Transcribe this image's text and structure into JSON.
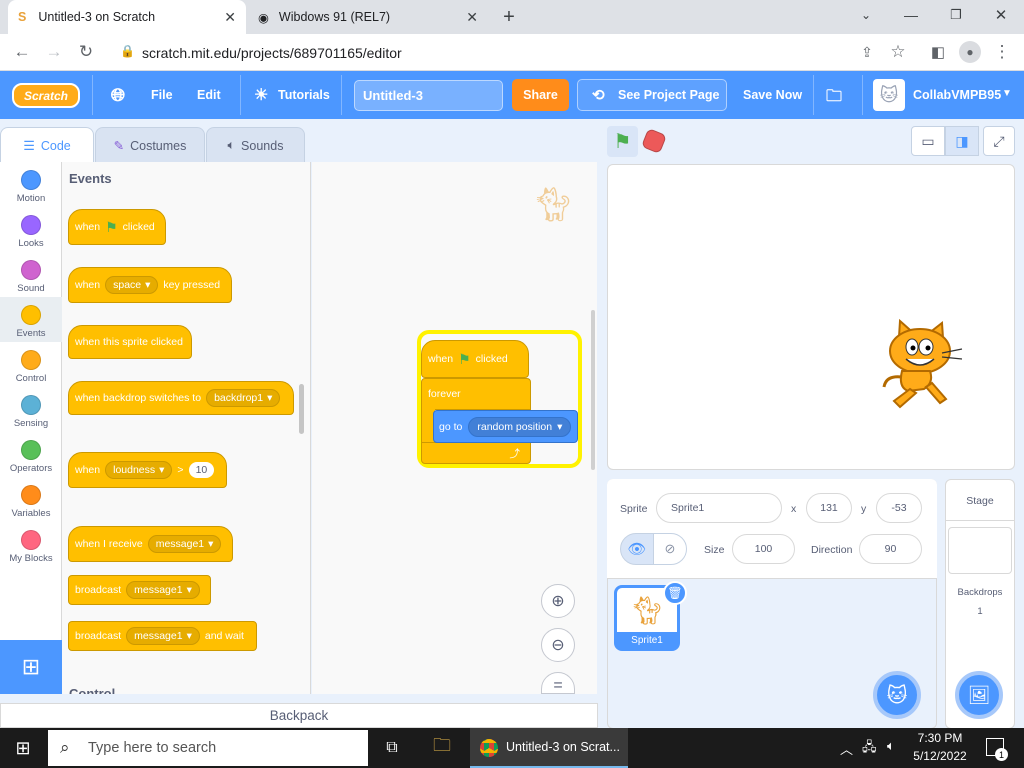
{
  "browser": {
    "tabs": [
      {
        "title": "Untitled-3 on Scratch"
      },
      {
        "title": "Wibdows 91 (REL7)"
      }
    ],
    "url": "scratch.mit.edu/projects/689701165/editor"
  },
  "menu": {
    "file": "File",
    "edit": "Edit",
    "tutorials": "Tutorials",
    "project_title": "Untitled-3",
    "share": "Share",
    "see_project": "See Project Page",
    "save_now": "Save Now",
    "username": "CollabVMPB95",
    "logo": "Scratch"
  },
  "editor_tabs": {
    "code": "Code",
    "costumes": "Costumes",
    "sounds": "Sounds"
  },
  "categories": [
    {
      "label": "Motion",
      "color": "#4c97ff"
    },
    {
      "label": "Looks",
      "color": "#9966ff"
    },
    {
      "label": "Sound",
      "color": "#cf63cf"
    },
    {
      "label": "Events",
      "color": "#ffbf00"
    },
    {
      "label": "Control",
      "color": "#ffab19"
    },
    {
      "label": "Sensing",
      "color": "#5cb1d6"
    },
    {
      "label": "Operators",
      "color": "#59c059"
    },
    {
      "label": "Variables",
      "color": "#ff8c1a"
    },
    {
      "label": "My Blocks",
      "color": "#ff6680"
    }
  ],
  "palette": {
    "heading": "Events",
    "next_heading": "Control",
    "when": "when",
    "clicked": "clicked",
    "space": "space",
    "key_pressed": "key pressed",
    "sprite_clicked": "when this sprite clicked",
    "backdrop_switches": "when backdrop switches to",
    "backdrop1": "backdrop1",
    "loudness": "loudness",
    "gt": ">",
    "ten": "10",
    "receive": "when I receive",
    "message1": "message1",
    "broadcast": "broadcast",
    "and_wait": "and wait"
  },
  "script": {
    "when": "when",
    "clicked": "clicked",
    "forever": "forever",
    "goto": "go to",
    "random": "random position",
    "loop_arrow": "⤴"
  },
  "sprite": {
    "label": "Sprite",
    "name": "Sprite1",
    "x_label": "x",
    "x": "131",
    "y_label": "y",
    "y": "-53",
    "size_label": "Size",
    "size": "100",
    "direction_label": "Direction",
    "direction": "90",
    "thumb_label": "Sprite1"
  },
  "stage_pane": {
    "title": "Stage",
    "backdrops_label": "Backdrops",
    "backdrops_count": "1"
  },
  "backpack": "Backpack",
  "taskbar": {
    "search": "Type here to search",
    "app": "Untitled-3 on Scrat...",
    "time": "7:30 PM",
    "date": "5/12/2022",
    "notif": "1"
  }
}
